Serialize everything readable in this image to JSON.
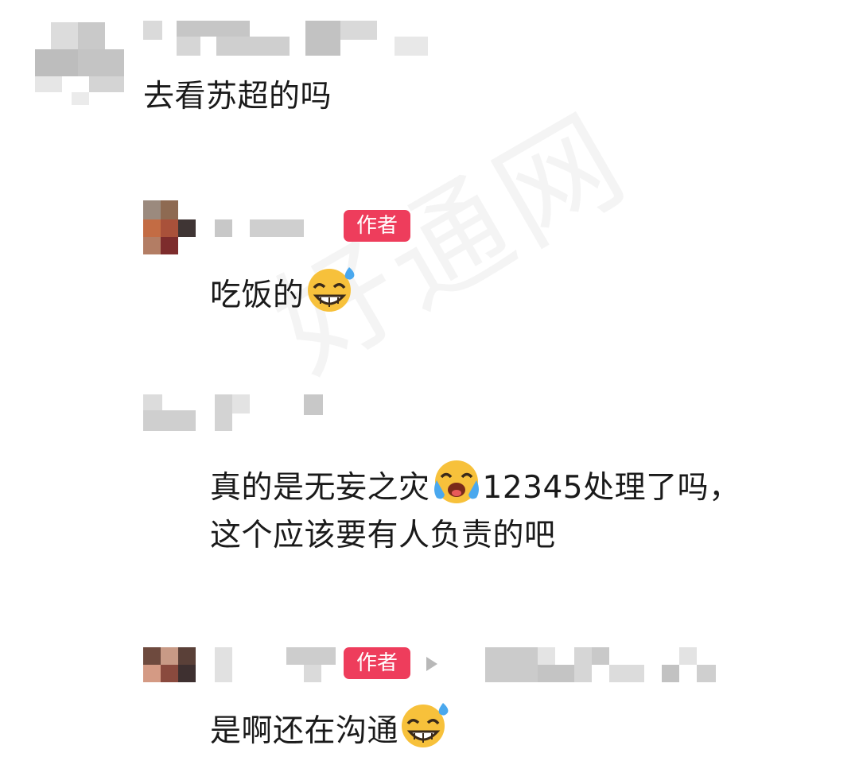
{
  "watermark": "好通网",
  "comments": [
    {
      "text": "去看苏超的吗"
    },
    {
      "badge": "作者",
      "text": "吃饭的",
      "emoji": "grinning-sweat-emoji"
    },
    {
      "text_line1": "真的是无妄之灾",
      "emoji": "crying-laughing-emoji",
      "text_line1_tail": "12345处理了吗，",
      "text_line2": "这个应该要有人负责的吧"
    },
    {
      "badge": "作者",
      "text": "是啊还在沟通",
      "emoji": "grinning-sweat-emoji"
    }
  ]
}
